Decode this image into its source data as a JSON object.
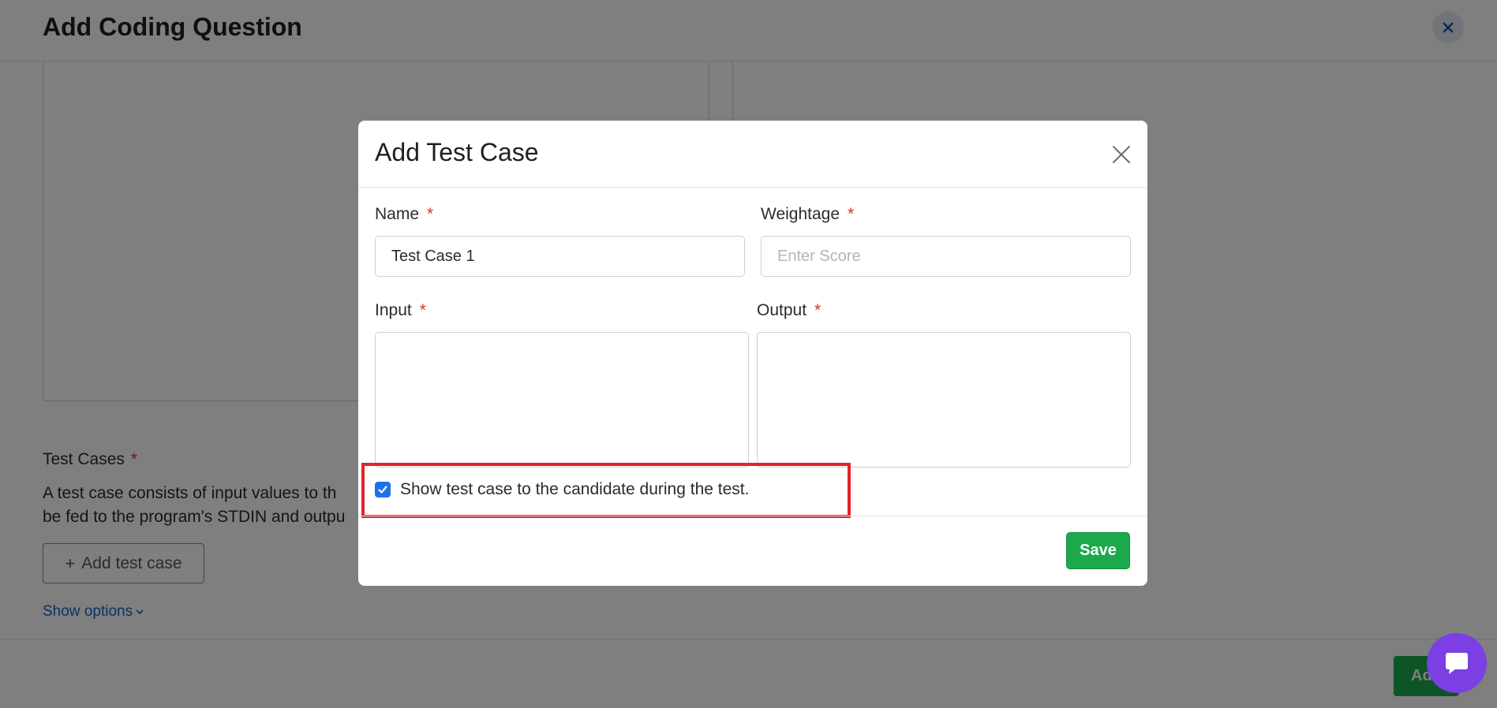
{
  "background": {
    "title": "Add Coding Question",
    "test_cases_label": "Test Cases",
    "required_mark": "*",
    "test_cases_description": "A test case consists of input values to th be fed to the program's STDIN and outpu",
    "test_cases_description_line1": "A test case consists of input values to th",
    "test_cases_description_line2": "be fed to the program's STDIN and outpu",
    "add_test_case_label": "Add test case",
    "add_test_case_plus": "+",
    "show_options_label": "Show options",
    "add_button_label": "Ad"
  },
  "modal": {
    "title": "Add Test Case",
    "fields": {
      "name": {
        "label": "Name",
        "value": "Test Case 1"
      },
      "weightage": {
        "label": "Weightage",
        "value": "",
        "placeholder": "Enter Score"
      },
      "input": {
        "label": "Input",
        "value": ""
      },
      "output": {
        "label": "Output",
        "value": ""
      }
    },
    "required_mark": "*",
    "show_to_candidate": {
      "label": "Show test case to the candidate during the test.",
      "checked": true
    },
    "save_label": "Save"
  },
  "colors": {
    "accent_green": "#1ba94c",
    "required_red": "#d32f2f",
    "checkbox_blue": "#1a73e8",
    "highlight_red": "#e0252b",
    "chat_purple": "#7b3fe4",
    "link_blue": "#1a5fc4"
  }
}
